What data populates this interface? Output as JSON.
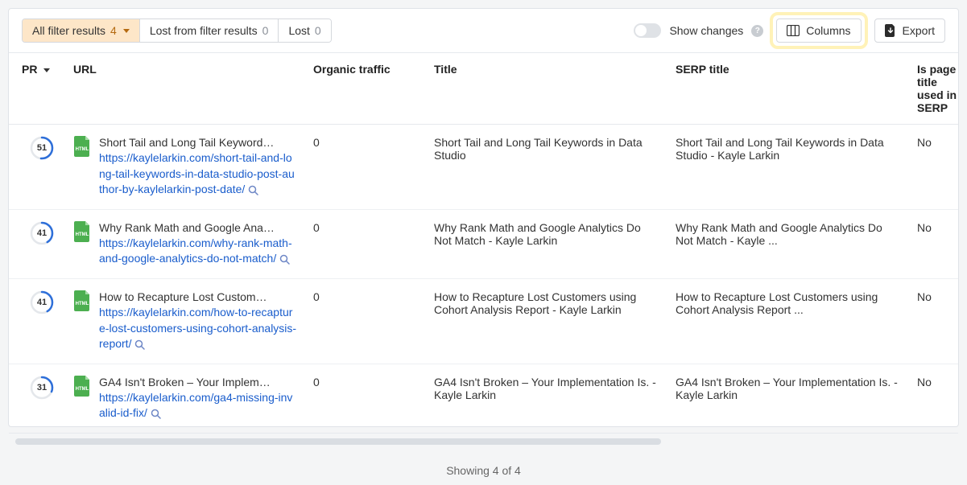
{
  "toolbar": {
    "tabs": [
      {
        "label": "All filter results",
        "count": "4"
      },
      {
        "label": "Lost from filter results",
        "count": "0"
      },
      {
        "label": "Lost",
        "count": "0"
      }
    ],
    "show_changes_label": "Show changes",
    "columns_label": "Columns",
    "export_label": "Export"
  },
  "columns": {
    "pr": "PR",
    "url": "URL",
    "organic_traffic": "Organic traffic",
    "title": "Title",
    "serp_title": "SERP title",
    "is_page": "Is page title used in SERP"
  },
  "rows": [
    {
      "pr": "51",
      "url_title": "Short Tail and Long Tail Keyword…",
      "url_link": "https://kaylelarkin.com/short-tail-and-long-tail-keywords-in-data-studio-post-author-by-kaylelarkin-post-date/",
      "organic": "0",
      "title": "Short Tail and Long Tail Keywords in Data Studio",
      "serp_title": "Short Tail and Long Tail Keywords in Data Studio - Kayle Larkin",
      "is_page": "No"
    },
    {
      "pr": "41",
      "url_title": "Why Rank Math and Google Ana…",
      "url_link": "https://kaylelarkin.com/why-rank-math-and-google-analytics-do-not-match/",
      "organic": "0",
      "title": "Why Rank Math and Google Analytics Do Not Match - Kayle Larkin",
      "serp_title": "Why Rank Math and Google Analytics Do Not Match - Kayle ...",
      "is_page": "No"
    },
    {
      "pr": "41",
      "url_title": "How to Recapture Lost Custom…",
      "url_link": "https://kaylelarkin.com/how-to-recapture-lost-customers-using-cohort-analysis-report/",
      "organic": "0",
      "title": "How to Recapture Lost Customers using Cohort Analysis Report - Kayle Larkin",
      "serp_title": "How to Recapture Lost Customers using Cohort Analysis Report ...",
      "is_page": "No"
    },
    {
      "pr": "31",
      "url_title": "GA4 Isn't Broken – Your Implem…",
      "url_link": "https://kaylelarkin.com/ga4-missing-invalid-id-fix/",
      "organic": "0",
      "title": "GA4 Isn't Broken – Your Implementation Is. - Kayle Larkin",
      "serp_title": "GA4 Isn't Broken – Your Implementation Is. - Kayle Larkin",
      "is_page": "No"
    }
  ],
  "footer": {
    "showing": "Showing 4 of 4"
  }
}
